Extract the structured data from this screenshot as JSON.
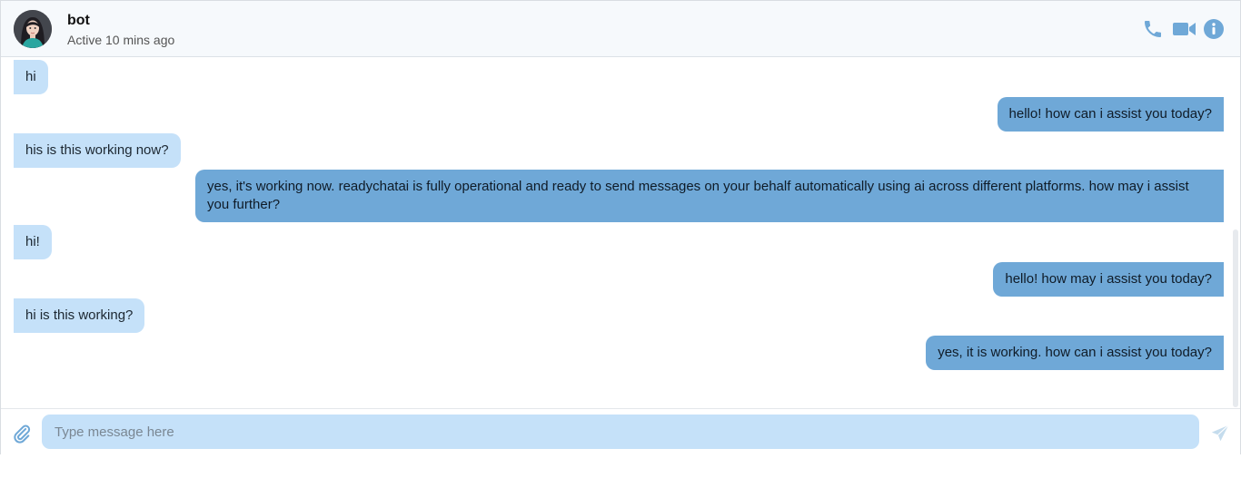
{
  "header": {
    "name": "bot",
    "status": "Active 10 mins ago",
    "icons": [
      "phone-icon",
      "video-icon",
      "info-icon"
    ],
    "accent_color": "#6fa8d7"
  },
  "messages": [
    {
      "from": "user",
      "text": "hi"
    },
    {
      "from": "bot",
      "text": "hello! how can i assist you today?"
    },
    {
      "from": "user",
      "text": "his is this working now?"
    },
    {
      "from": "bot",
      "text": "yes, it's working now. readychatai is fully operational and ready to send messages on your behalf automatically using ai across different platforms. how may i assist you further?"
    },
    {
      "from": "user",
      "text": "hi!"
    },
    {
      "from": "bot",
      "text": "hello! how may i assist you today?"
    },
    {
      "from": "user",
      "text": "hi is this working?"
    },
    {
      "from": "bot",
      "text": "yes, it is working. how can i assist you today?"
    }
  ],
  "composer": {
    "placeholder": "Type message here",
    "value": "",
    "icons": [
      "paperclip-icon",
      "send-icon"
    ]
  },
  "colors": {
    "incoming_bubble": "#c5e1f9",
    "outgoing_bubble": "#6fa8d7",
    "header_bg": "#f6f9fc"
  }
}
